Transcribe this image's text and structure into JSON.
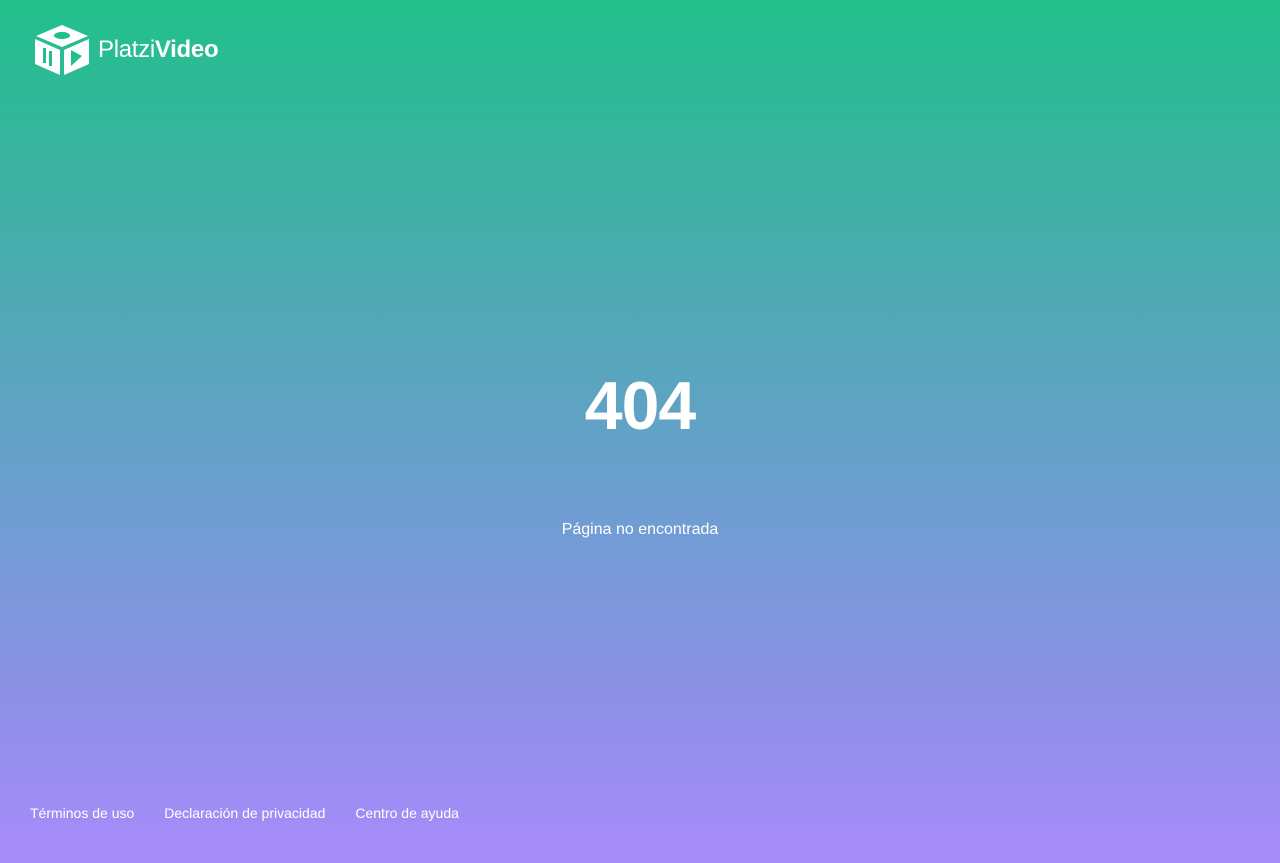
{
  "header": {
    "logo_text_light": "Platzi",
    "logo_text_bold": "Video",
    "logo_icon": "platzi-video-cube-icon"
  },
  "main": {
    "error_code": "404",
    "error_message": "Página no encontrada"
  },
  "footer": {
    "links": [
      {
        "label": "Términos de uso"
      },
      {
        "label": "Declaración de privacidad"
      },
      {
        "label": "Centro de ayuda"
      }
    ]
  },
  "colors": {
    "gradient_top": "#21c08b",
    "gradient_bottom": "#a88bfb",
    "text": "#ffffff"
  }
}
